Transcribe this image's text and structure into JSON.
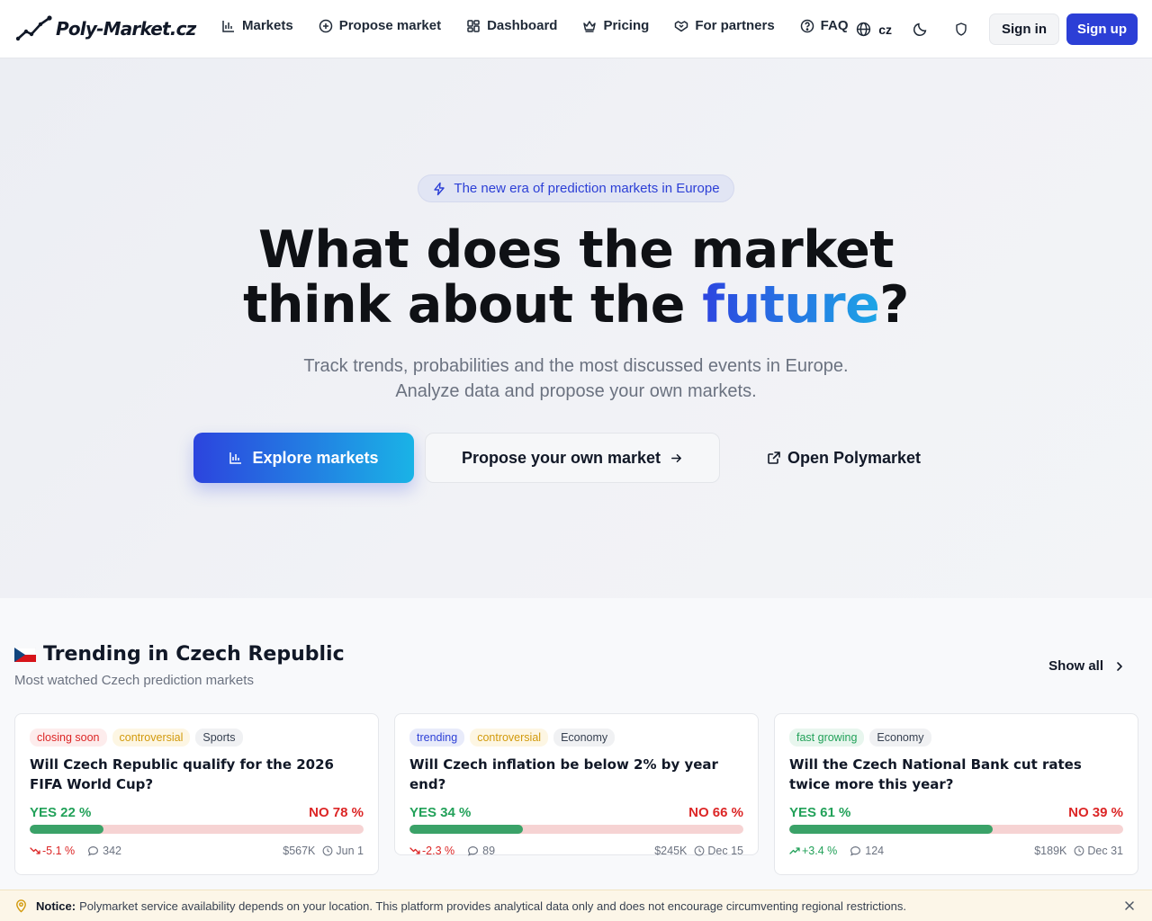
{
  "brand": {
    "logo_text": "Poly-Market.cz"
  },
  "nav": [
    {
      "label": "Markets",
      "icon": "bar-chart-icon"
    },
    {
      "label": "Propose market",
      "icon": "plus-circle-icon"
    },
    {
      "label": "Dashboard",
      "icon": "dashboard-icon"
    },
    {
      "label": "Pricing",
      "icon": "crown-icon"
    },
    {
      "label": "For partners",
      "icon": "handshake-icon"
    },
    {
      "label": "FAQ",
      "icon": "help-circle-icon"
    }
  ],
  "header": {
    "lang": "cz",
    "sign_in": "Sign in",
    "sign_up": "Sign up"
  },
  "hero": {
    "badge": "The new era of prediction markets in Europe",
    "title_line1": "What does the market",
    "title_line2_pre": "think about the ",
    "title_highlight": "future",
    "title_end": "?",
    "sub_line1": "Track trends, probabilities and the most discussed events in Europe.",
    "sub_line2": "Analyze data and propose your own markets.",
    "cta_explore": "Explore markets",
    "cta_propose": "Propose your own market",
    "cta_open": "Open Polymarket"
  },
  "trending": {
    "title": "Trending in Czech Republic",
    "subtitle": "Most watched Czech prediction markets",
    "show_all": "Show all",
    "cards": [
      {
        "tags": [
          {
            "label": "closing soon",
            "tone": "red"
          },
          {
            "label": "controversial",
            "tone": "amber"
          },
          {
            "label": "Sports",
            "tone": "grey"
          }
        ],
        "title": "Will Czech Republic qualify for the 2026 FIFA World Cup?",
        "yes": "YES 22 %",
        "no": "NO 78 %",
        "yes_pct": 22,
        "change": "-5.1 %",
        "trend": "down",
        "comments": "342",
        "volume": "$567K",
        "date": "Jun 1"
      },
      {
        "tags": [
          {
            "label": "trending",
            "tone": "blue"
          },
          {
            "label": "controversial",
            "tone": "amber"
          },
          {
            "label": "Economy",
            "tone": "grey"
          }
        ],
        "title": "Will Czech inflation be below 2% by year end?",
        "yes": "YES 34 %",
        "no": "NO 66 %",
        "yes_pct": 34,
        "change": "-2.3 %",
        "trend": "down",
        "comments": "89",
        "volume": "$245K",
        "date": "Dec 15"
      },
      {
        "tags": [
          {
            "label": "fast growing",
            "tone": "green"
          },
          {
            "label": "Economy",
            "tone": "grey"
          }
        ],
        "title": "Will the Czech National Bank cut rates twice more this year?",
        "yes": "YES 61 %",
        "no": "NO 39 %",
        "yes_pct": 61,
        "change": "+3.4 %",
        "trend": "up",
        "comments": "124",
        "volume": "$189K",
        "date": "Dec 31"
      }
    ]
  },
  "notice": {
    "label": "Notice:",
    "text": "Polymarket service availability depends on your location. This platform provides analytical data only and does not encourage circumventing regional restrictions."
  },
  "colors": {
    "accent": "#2c3fd6",
    "yes": "#22a159",
    "no": "#dc2626",
    "notice_bg": "#fcf6e8"
  }
}
